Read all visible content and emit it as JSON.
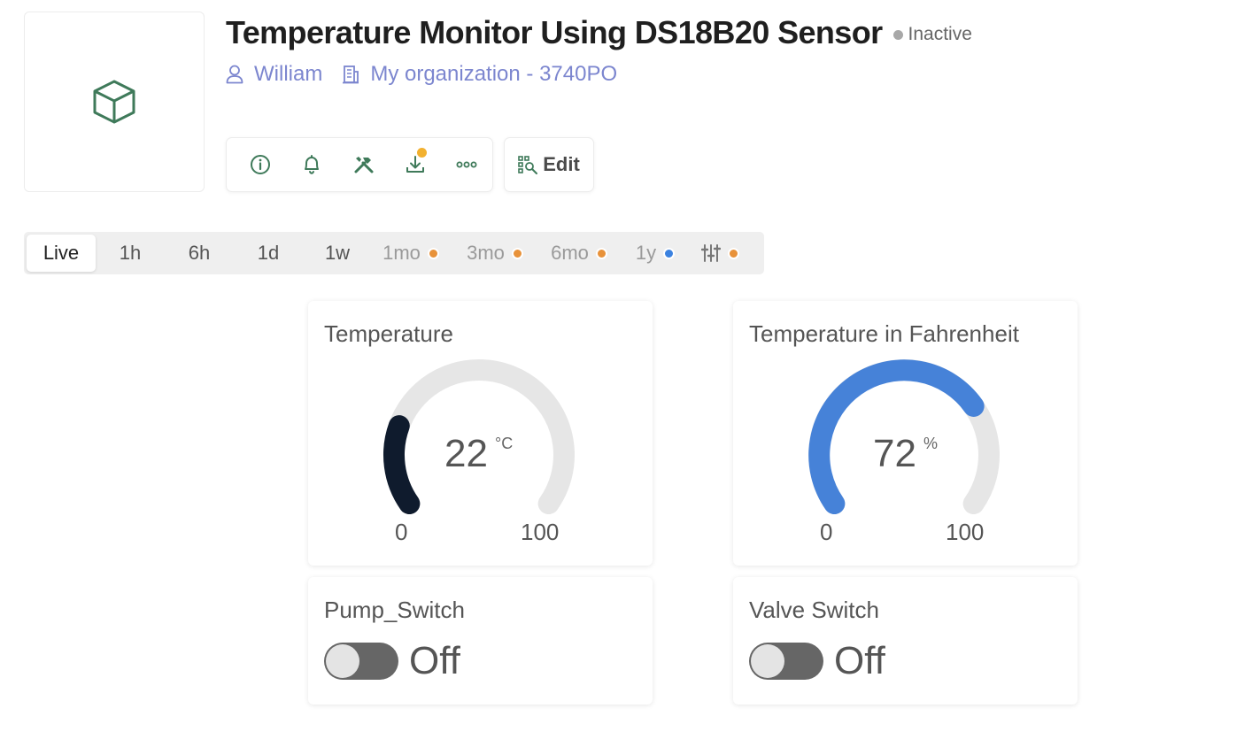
{
  "header": {
    "title": "Temperature Monitor Using DS18B20 Sensor",
    "status": "Inactive",
    "owner": "William",
    "organization": "My organization - 3740PO",
    "thumbnail_icon": "cube-icon",
    "accent_color": "#3f7a5a"
  },
  "toolbar": {
    "actions": [
      {
        "icon": "info-icon"
      },
      {
        "icon": "bell-icon"
      },
      {
        "icon": "tools-icon"
      },
      {
        "icon": "download-icon"
      },
      {
        "icon": "more-icon"
      }
    ],
    "edit_label": "Edit"
  },
  "time_range": {
    "selected": "Live",
    "options": [
      {
        "label": "Live",
        "dot": null
      },
      {
        "label": "1h",
        "dot": null
      },
      {
        "label": "6h",
        "dot": null
      },
      {
        "label": "1d",
        "dot": null
      },
      {
        "label": "1w",
        "dot": null
      },
      {
        "label": "1mo",
        "dot": "#e8923a"
      },
      {
        "label": "3mo",
        "dot": "#e8923a"
      },
      {
        "label": "6mo",
        "dot": "#e8923a"
      },
      {
        "label": "1y",
        "dot": "#3b82e0"
      },
      {
        "label": "",
        "icon": "sliders-icon",
        "dot": "#e8923a"
      }
    ]
  },
  "widgets": {
    "gauge1": {
      "title": "Temperature",
      "value": 22,
      "unit": "°C",
      "min": 0,
      "max": 100,
      "color": "#0f1b2d"
    },
    "gauge2": {
      "title": "Temperature in Fahrenheit",
      "value": 72,
      "unit": "%",
      "min": 0,
      "max": 100,
      "color": "#4682d8"
    },
    "switch1": {
      "title": "Pump_Switch",
      "state": "Off"
    },
    "switch2": {
      "title": "Valve Switch",
      "state": "Off"
    }
  }
}
